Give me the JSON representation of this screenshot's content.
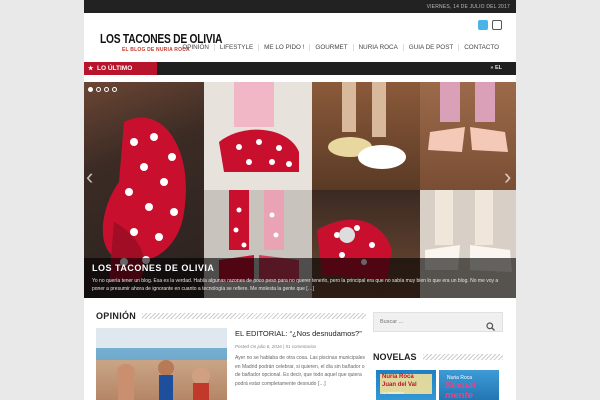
{
  "topbar": {
    "date": "VIERNES, 14 DE JULIO DEL 2017"
  },
  "logo": {
    "title": "LOS TACONES DE OLIVIA",
    "subtitle": "EL BLOG DE NURIA ROCA"
  },
  "nav": {
    "items": [
      "OPINIÓN",
      "LIFESTYLE",
      "ME LO PIDO !",
      "GOURMET",
      "NURIA ROCA",
      "GUIA DE POST",
      "CONTACTO"
    ]
  },
  "ticker": {
    "label": "LO ÚLTIMO",
    "text": "» EL"
  },
  "slider": {
    "title": "LOS TACONES DE OLIVIA",
    "text": "Yo no quería tener un blog. Esa es la verdad. Había algunas razones de poco peso para no querer tenerlo, pero la principal era que no sabía muy bien lo que era un blog. No me voy a poner a presumir ahora de ignorante en cuanto a tecnología se refiere. Me molesta la gente que […]"
  },
  "opinion": {
    "heading": "OPINIÓN",
    "article": {
      "title": "EL EDITORIAL: “¿Nos desnudamos?”",
      "meta": "Posted On julio 6, 2016 | 51 comentarios",
      "excerpt": "Ayer no se hablaba de otra cosa. Las piscinas municipales en Madrid podrán celebrar, si quieren, el día sin bañador o de bañador opcional. Es decir, que todo aquel que quiera podrá estar completamente desnudo […]"
    }
  },
  "sidebar": {
    "search_placeholder": "Buscar ...",
    "novelas_heading": "NOVELAS",
    "book1": {
      "author": "Nuria Roca",
      "coauthor": "Juan del Val",
      "tag": "La tentación"
    },
    "book2": {
      "author": "Nuria Roca",
      "title": "Sexual mente"
    }
  },
  "colors": {
    "accent": "#b8142c",
    "topbar": "#222222",
    "ticker": "#1f1f1f"
  }
}
